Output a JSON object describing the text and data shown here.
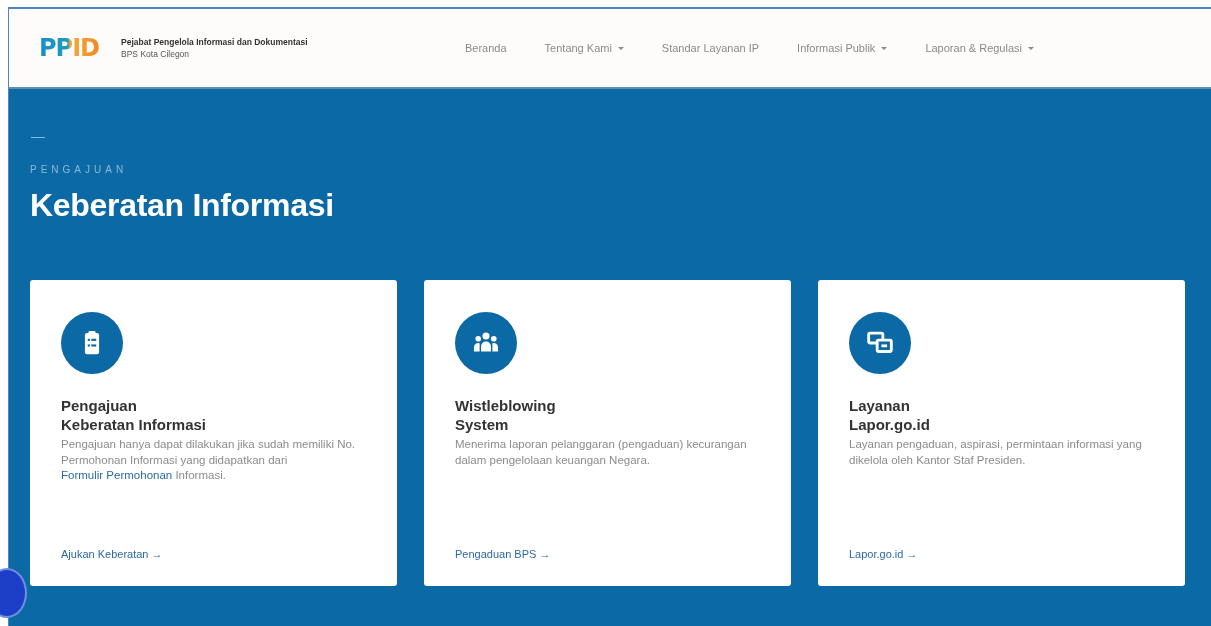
{
  "header": {
    "logo": "PPID",
    "org_name": "Pejabat Pengelola Informasi dan Dokumentasi",
    "org_sub": "BPS Kota Cilegon",
    "nav": [
      {
        "label": "Beranda",
        "has_menu": false
      },
      {
        "label": "Tentang Kami",
        "has_menu": true
      },
      {
        "label": "Standar Layanan IP",
        "has_menu": false
      },
      {
        "label": "Informasi Publik",
        "has_menu": true
      },
      {
        "label": "Laporan & Regulasi",
        "has_menu": true
      }
    ]
  },
  "hero": {
    "eyebrow": "PENGAJUAN",
    "title": "Keberatan Informasi"
  },
  "cards": [
    {
      "title_lines": [
        "Pengajuan",
        "Keberatan Informasi"
      ],
      "description": [
        {
          "kind": "text",
          "text": "Pengajuan hanya dapat dilakukan jika sudah memiliki No. Permohonan Informasi yang didapatkan dari"
        },
        {
          "kind": "link",
          "text": "Formulir Permohonan"
        },
        {
          "kind": "text",
          "text": "Informasi."
        }
      ],
      "action": "Ajukan Keberatan →"
    },
    {
      "title_lines": [
        "Wistleblowing",
        "System"
      ],
      "description": [
        {
          "kind": "text",
          "text": "Menerima laporan pelanggaran (pengaduan) kecurangan dalam pengelolaan keuangan Negara."
        }
      ],
      "action": "Pengaduan BPS →"
    },
    {
      "title_lines": [
        "Layanan",
        "Lapor.go.id"
      ],
      "description": [
        {
          "kind": "text",
          "text": "Layanan pengaduan, aspirasi, permintaan informasi yang dikelola oleh Kantor Staf Presiden."
        }
      ],
      "action": "Lapor.go.id →"
    }
  ]
}
